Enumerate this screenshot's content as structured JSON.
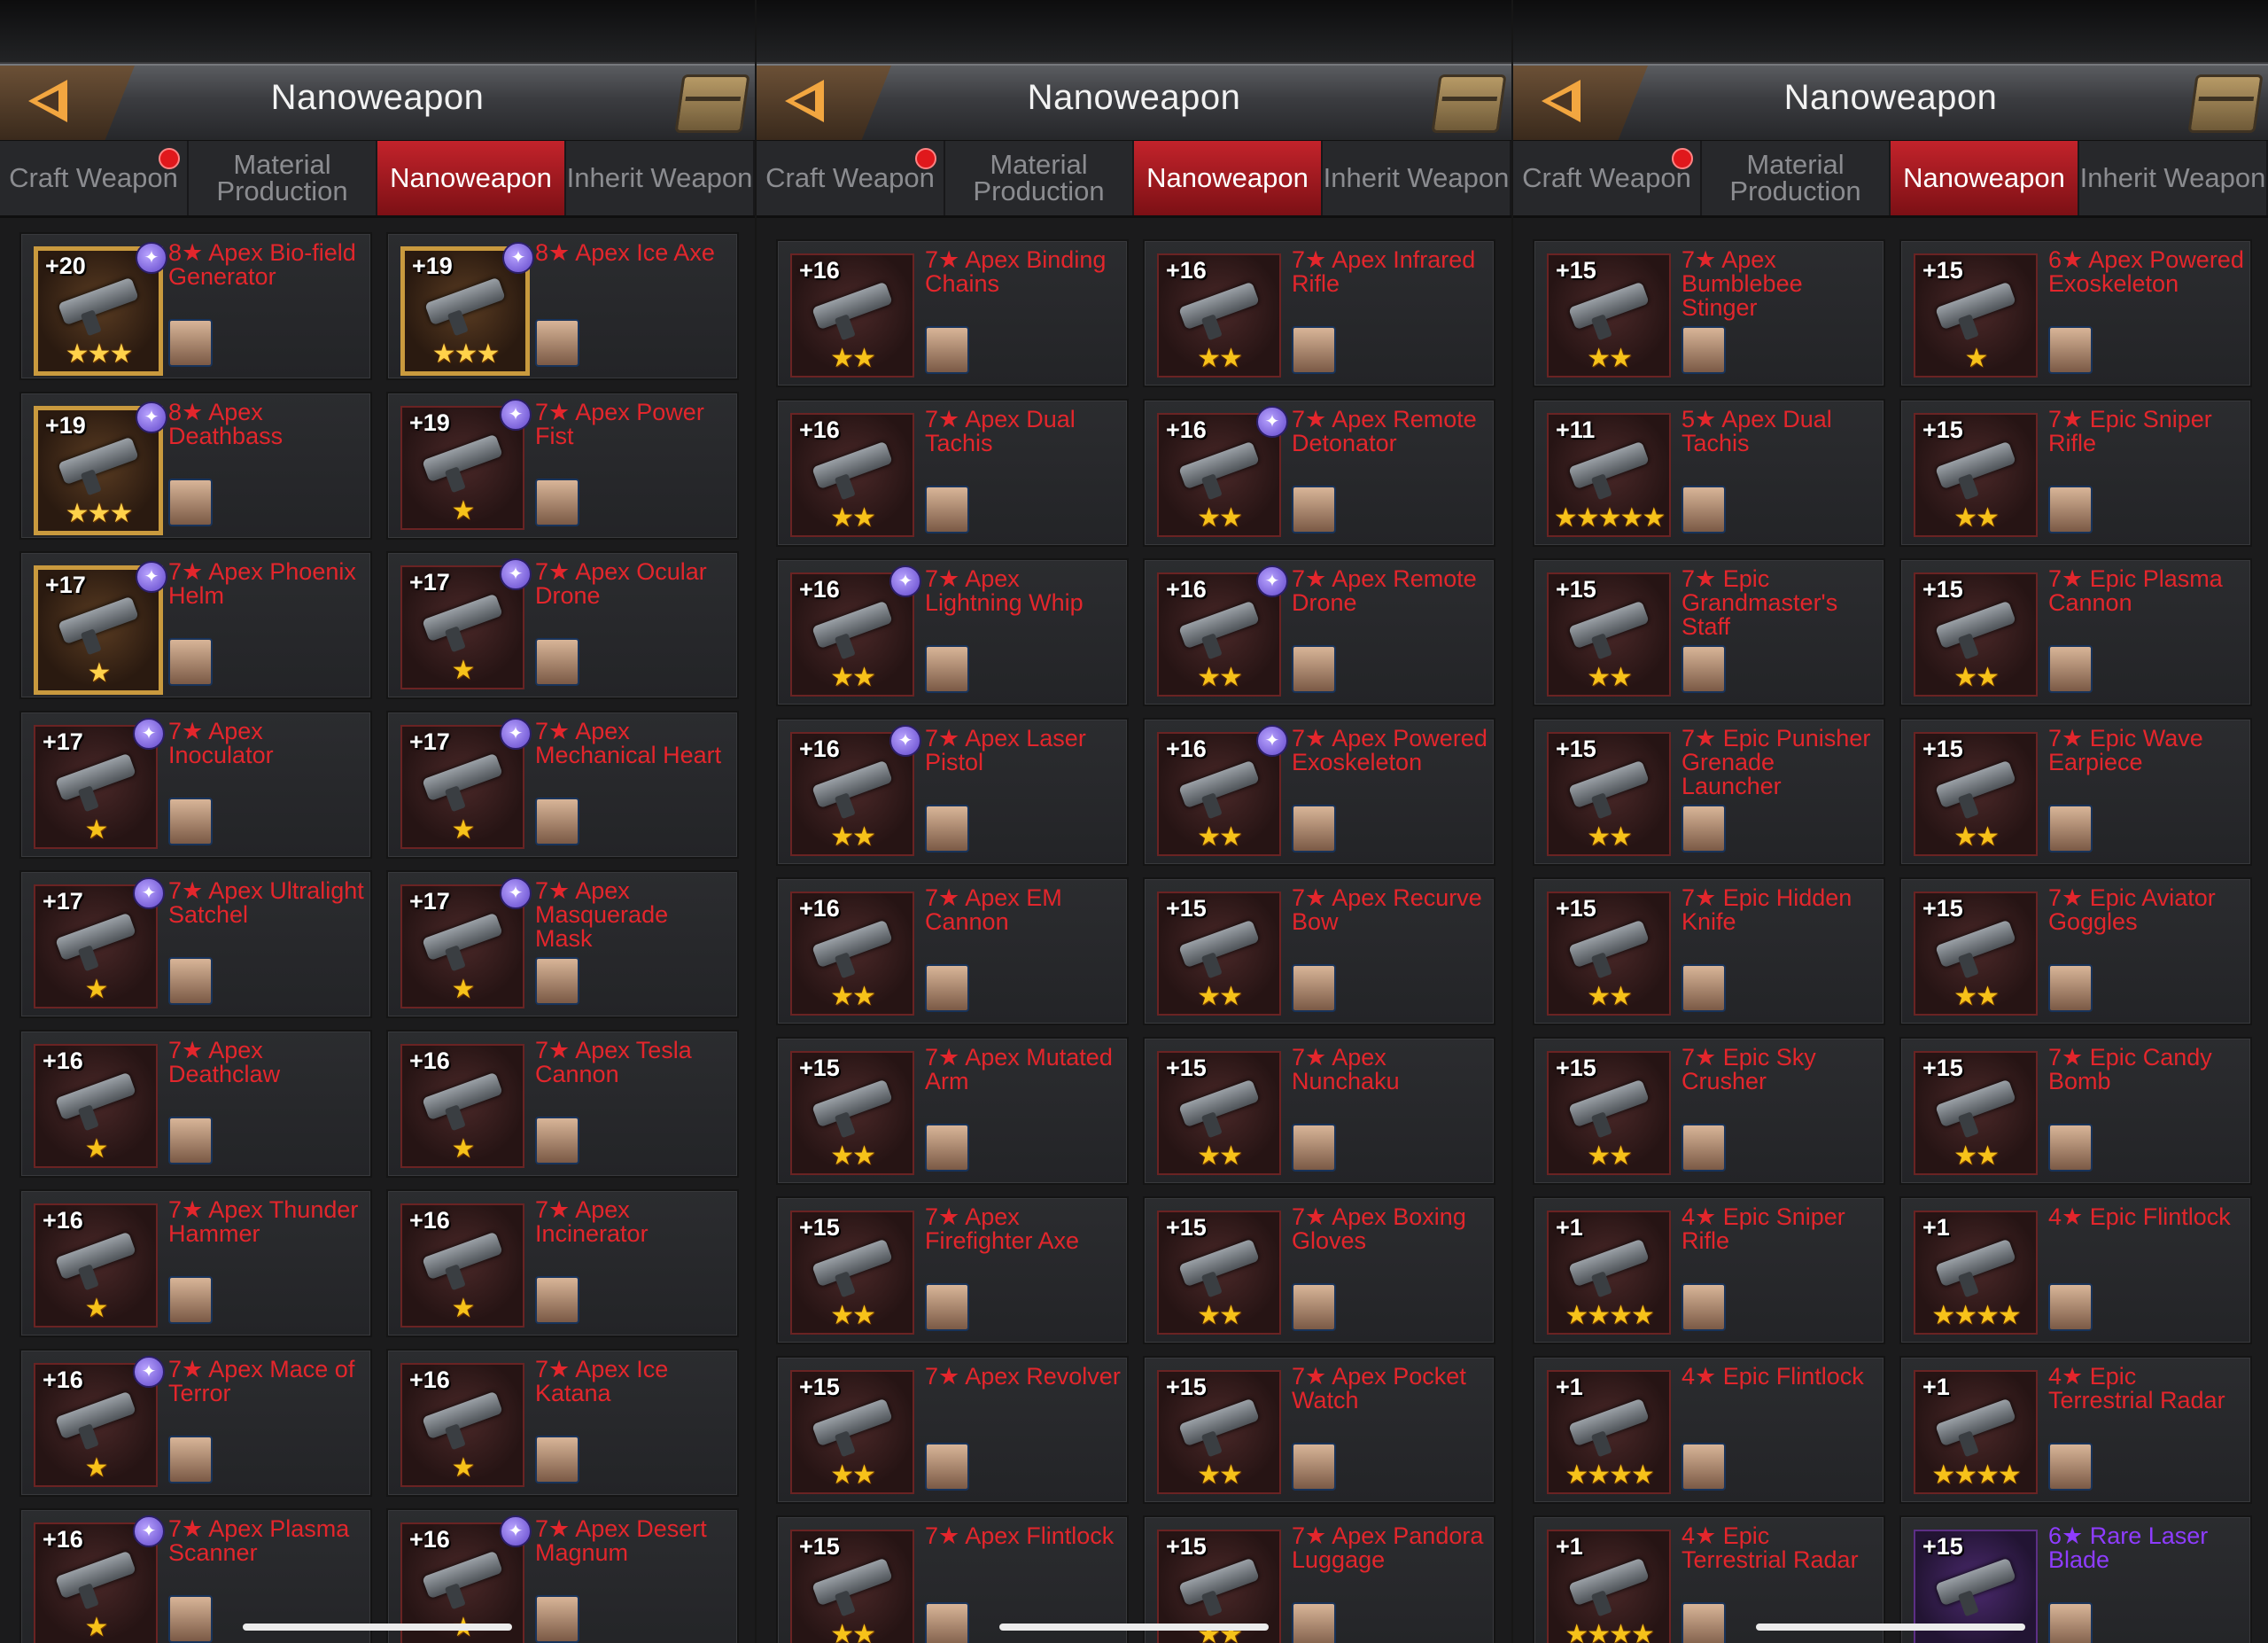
{
  "panels": [
    {
      "title": "Nanoweapon",
      "tabs": [
        {
          "label": "Craft Weapon",
          "active": false,
          "dot": true
        },
        {
          "label": "Material Production",
          "active": false,
          "dot": false
        },
        {
          "label": "Nanoweapon",
          "active": true,
          "dot": false
        },
        {
          "label": "Inherit Weapon",
          "active": false,
          "dot": false
        }
      ],
      "cards": [
        {
          "level": "+20",
          "name": "8★ Apex Bio-field Generator",
          "stars": "★★★",
          "rank": "gold",
          "badge": true,
          "color": "red"
        },
        {
          "level": "+19",
          "name": "8★ Apex Ice Axe",
          "stars": "★★★",
          "rank": "gold",
          "badge": true,
          "color": "red"
        },
        {
          "level": "+19",
          "name": "8★ Apex Deathbass",
          "stars": "★★★",
          "rank": "gold",
          "badge": true,
          "color": "red"
        },
        {
          "level": "+19",
          "name": "7★ Apex Power Fist",
          "stars": "★",
          "rank": "normal",
          "badge": true,
          "color": "red"
        },
        {
          "level": "+17",
          "name": "7★ Apex Phoenix Helm",
          "stars": "★",
          "rank": "gold",
          "badge": true,
          "color": "red"
        },
        {
          "level": "+17",
          "name": "7★ Apex Ocular Drone",
          "stars": "★",
          "rank": "normal",
          "badge": true,
          "color": "red"
        },
        {
          "level": "+17",
          "name": "7★ Apex Inoculator",
          "stars": "★",
          "rank": "normal",
          "badge": true,
          "color": "red"
        },
        {
          "level": "+17",
          "name": "7★ Apex Mechanical Heart",
          "stars": "★",
          "rank": "normal",
          "badge": true,
          "color": "red"
        },
        {
          "level": "+17",
          "name": "7★ Apex Ultralight Satchel",
          "stars": "★",
          "rank": "normal",
          "badge": true,
          "color": "red"
        },
        {
          "level": "+17",
          "name": "7★ Apex Masquerade Mask",
          "stars": "★",
          "rank": "normal",
          "badge": true,
          "color": "red"
        },
        {
          "level": "+16",
          "name": "7★ Apex Deathclaw",
          "stars": "★",
          "rank": "normal",
          "badge": false,
          "color": "red"
        },
        {
          "level": "+16",
          "name": "7★ Apex Tesla Cannon",
          "stars": "★",
          "rank": "normal",
          "badge": false,
          "color": "red"
        },
        {
          "level": "+16",
          "name": "7★ Apex Thunder Hammer",
          "stars": "★",
          "rank": "normal",
          "badge": false,
          "color": "red"
        },
        {
          "level": "+16",
          "name": "7★ Apex Incinerator",
          "stars": "★",
          "rank": "normal",
          "badge": false,
          "color": "red"
        },
        {
          "level": "+16",
          "name": "7★ Apex Mace of Terror",
          "stars": "★",
          "rank": "normal",
          "badge": true,
          "color": "red"
        },
        {
          "level": "+16",
          "name": "7★ Apex Ice Katana",
          "stars": "★",
          "rank": "normal",
          "badge": false,
          "color": "red"
        },
        {
          "level": "+16",
          "name": "7★ Apex Plasma Scanner",
          "stars": "★",
          "rank": "normal",
          "badge": true,
          "color": "red"
        },
        {
          "level": "+16",
          "name": "7★ Apex Desert Magnum",
          "stars": "★",
          "rank": "normal",
          "badge": true,
          "color": "red"
        }
      ]
    },
    {
      "title": "Nanoweapon",
      "tabs": [
        {
          "label": "Craft Weapon",
          "active": false,
          "dot": true
        },
        {
          "label": "Material Production",
          "active": false,
          "dot": false
        },
        {
          "label": "Nanoweapon",
          "active": true,
          "dot": false
        },
        {
          "label": "Inherit Weapon",
          "active": false,
          "dot": false
        }
      ],
      "cards": [
        {
          "level": "+16",
          "name": "7★ Apex Binding Chains",
          "stars": "★★",
          "rank": "normal",
          "badge": false,
          "color": "red"
        },
        {
          "level": "+16",
          "name": "7★ Apex Infrared Rifle",
          "stars": "★★",
          "rank": "normal",
          "badge": false,
          "color": "red"
        },
        {
          "level": "+16",
          "name": "7★ Apex Dual Tachis",
          "stars": "★★",
          "rank": "normal",
          "badge": false,
          "color": "red"
        },
        {
          "level": "+16",
          "name": "7★ Apex Remote Detonator",
          "stars": "★★",
          "rank": "normal",
          "badge": true,
          "color": "red"
        },
        {
          "level": "+16",
          "name": "7★ Apex Lightning Whip",
          "stars": "★★",
          "rank": "normal",
          "badge": true,
          "color": "red"
        },
        {
          "level": "+16",
          "name": "7★ Apex Remote Drone",
          "stars": "★★",
          "rank": "normal",
          "badge": true,
          "color": "red"
        },
        {
          "level": "+16",
          "name": "7★ Apex Laser Pistol",
          "stars": "★★",
          "rank": "normal",
          "badge": true,
          "color": "red"
        },
        {
          "level": "+16",
          "name": "7★ Apex Powered Exoskeleton",
          "stars": "★★",
          "rank": "normal",
          "badge": true,
          "color": "red"
        },
        {
          "level": "+16",
          "name": "7★ Apex EM Cannon",
          "stars": "★★",
          "rank": "normal",
          "badge": false,
          "color": "red"
        },
        {
          "level": "+15",
          "name": "7★ Apex Recurve Bow",
          "stars": "★★",
          "rank": "normal",
          "badge": false,
          "color": "red"
        },
        {
          "level": "+15",
          "name": "7★ Apex Mutated Arm",
          "stars": "★★",
          "rank": "normal",
          "badge": false,
          "color": "red"
        },
        {
          "level": "+15",
          "name": "7★ Apex Nunchaku",
          "stars": "★★",
          "rank": "normal",
          "badge": false,
          "color": "red"
        },
        {
          "level": "+15",
          "name": "7★ Apex Firefighter Axe",
          "stars": "★★",
          "rank": "normal",
          "badge": false,
          "color": "red"
        },
        {
          "level": "+15",
          "name": "7★ Apex Boxing Gloves",
          "stars": "★★",
          "rank": "normal",
          "badge": false,
          "color": "red"
        },
        {
          "level": "+15",
          "name": "7★ Apex Revolver",
          "stars": "★★",
          "rank": "normal",
          "badge": false,
          "color": "red"
        },
        {
          "level": "+15",
          "name": "7★ Apex Pocket Watch",
          "stars": "★★",
          "rank": "normal",
          "badge": false,
          "color": "red"
        },
        {
          "level": "+15",
          "name": "7★ Apex Flintlock",
          "stars": "★★",
          "rank": "normal",
          "badge": false,
          "color": "red"
        },
        {
          "level": "+15",
          "name": "7★ Apex Pandora Luggage",
          "stars": "★★",
          "rank": "normal",
          "badge": false,
          "color": "red"
        }
      ]
    },
    {
      "title": "Nanoweapon",
      "tabs": [
        {
          "label": "Craft Weapon",
          "active": false,
          "dot": true
        },
        {
          "label": "Material Production",
          "active": false,
          "dot": false
        },
        {
          "label": "Nanoweapon",
          "active": true,
          "dot": false
        },
        {
          "label": "Inherit Weapon",
          "active": false,
          "dot": false
        }
      ],
      "cards": [
        {
          "level": "+15",
          "name": "7★ Apex Bumblebee Stinger",
          "stars": "★★",
          "rank": "normal",
          "badge": false,
          "color": "red"
        },
        {
          "level": "+15",
          "name": "6★ Apex Powered Exoskeleton",
          "stars": "★",
          "rank": "normal",
          "badge": false,
          "color": "red"
        },
        {
          "level": "+11",
          "name": "5★ Apex Dual Tachis",
          "stars": "★★★★★",
          "rank": "normal",
          "badge": false,
          "color": "red"
        },
        {
          "level": "+15",
          "name": "7★ Epic Sniper Rifle",
          "stars": "★★",
          "rank": "normal",
          "badge": false,
          "color": "red"
        },
        {
          "level": "+15",
          "name": "7★ Epic Grandmaster's Staff",
          "stars": "★★",
          "rank": "normal",
          "badge": false,
          "color": "red"
        },
        {
          "level": "+15",
          "name": "7★ Epic Plasma Cannon",
          "stars": "★★",
          "rank": "normal",
          "badge": false,
          "color": "red"
        },
        {
          "level": "+15",
          "name": "7★ Epic Punisher Grenade Launcher",
          "stars": "★★",
          "rank": "normal",
          "badge": false,
          "color": "red"
        },
        {
          "level": "+15",
          "name": "7★ Epic Wave Earpiece",
          "stars": "★★",
          "rank": "normal",
          "badge": false,
          "color": "red"
        },
        {
          "level": "+15",
          "name": "7★ Epic Hidden Knife",
          "stars": "★★",
          "rank": "normal",
          "badge": false,
          "color": "red"
        },
        {
          "level": "+15",
          "name": "7★ Epic Aviator Goggles",
          "stars": "★★",
          "rank": "normal",
          "badge": false,
          "color": "red"
        },
        {
          "level": "+15",
          "name": "7★ Epic Sky Crusher",
          "stars": "★★",
          "rank": "normal",
          "badge": false,
          "color": "red"
        },
        {
          "level": "+15",
          "name": "7★ Epic Candy Bomb",
          "stars": "★★",
          "rank": "normal",
          "badge": false,
          "color": "red"
        },
        {
          "level": "+1",
          "name": "4★ Epic Sniper Rifle",
          "stars": "★★★★",
          "rank": "normal",
          "badge": false,
          "color": "red"
        },
        {
          "level": "+1",
          "name": "4★ Epic Flintlock",
          "stars": "★★★★",
          "rank": "normal",
          "badge": false,
          "color": "red"
        },
        {
          "level": "+1",
          "name": "4★ Epic Flintlock",
          "stars": "★★★★",
          "rank": "normal",
          "badge": false,
          "color": "red"
        },
        {
          "level": "+1",
          "name": "4★ Epic Terrestrial Radar",
          "stars": "★★★★",
          "rank": "normal",
          "badge": false,
          "color": "red"
        },
        {
          "level": "+1",
          "name": "4★ Epic Terrestrial Radar",
          "stars": "★★★★",
          "rank": "normal",
          "badge": false,
          "color": "red"
        },
        {
          "level": "+15",
          "name": "6★ Rare Laser Blade",
          "stars": "",
          "rank": "purple",
          "badge": false,
          "color": "purple"
        }
      ]
    }
  ],
  "icons": {
    "back": "back-arrow-icon",
    "chest": "treasure-chest-icon",
    "badge": "nano-swirl-icon"
  },
  "colors": {
    "active_tab": "#c3232b",
    "name_red": "#e3262c",
    "name_purple": "#8e3cff",
    "star": "#f6c21a",
    "notification_dot": "#e0181c"
  }
}
